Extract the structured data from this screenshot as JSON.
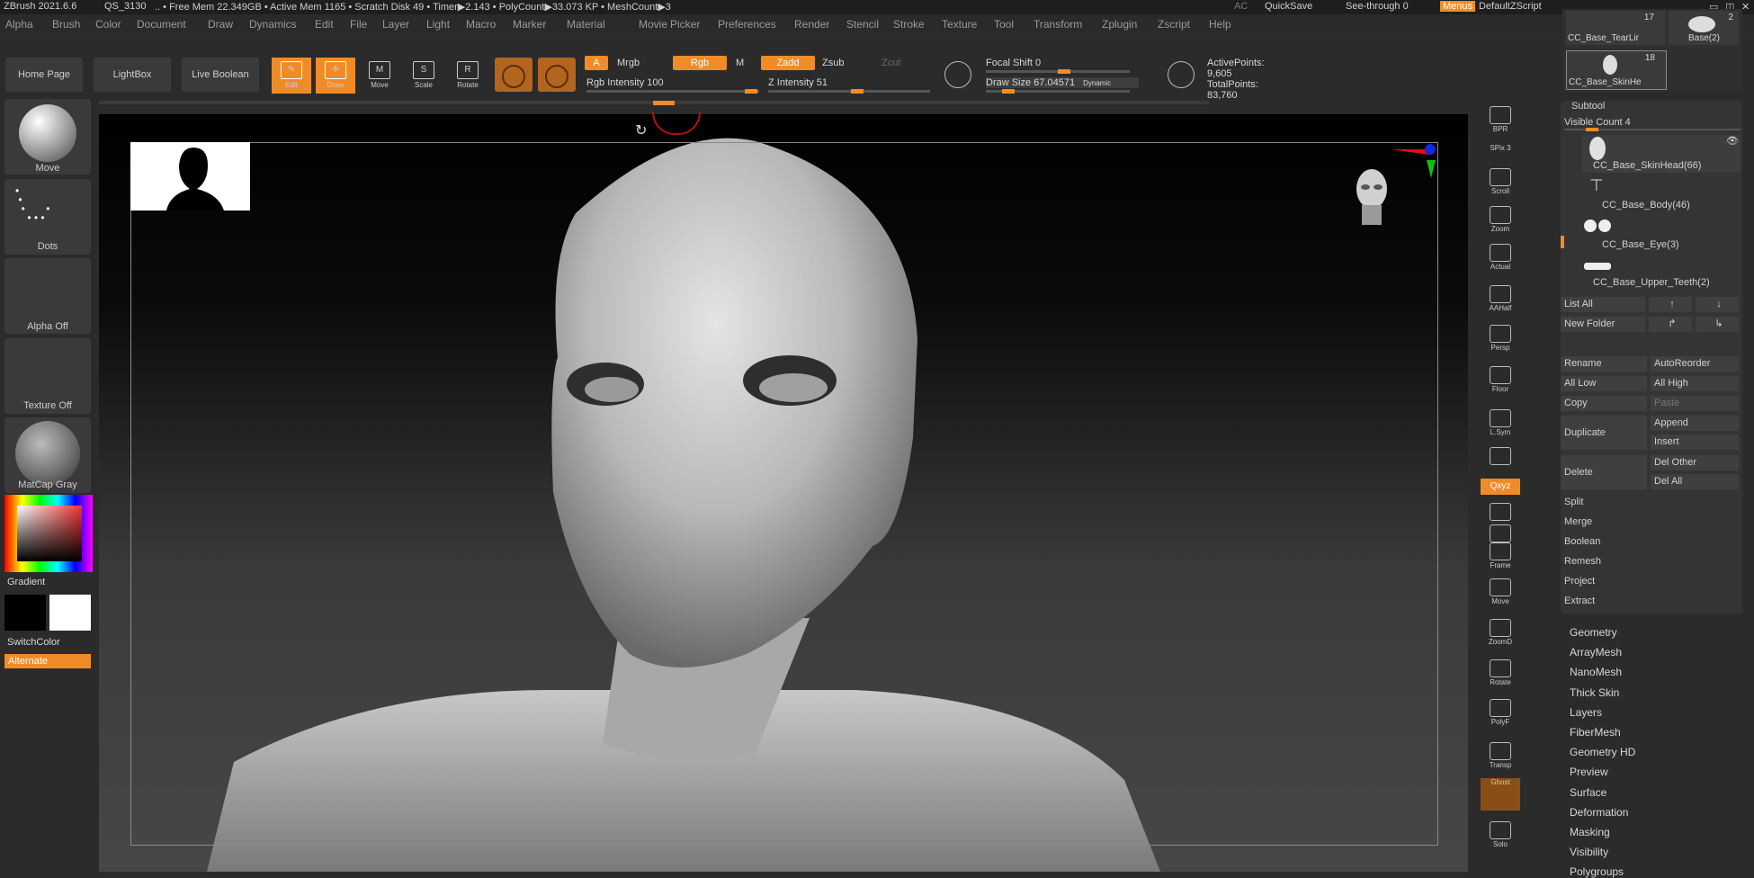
{
  "titlebar": {
    "app": "ZBrush 2021.6.6",
    "qs": "QS_3130",
    "stats": ".. • Free Mem 22.349GB • Active Mem 1165 • Scratch Disk 49 • Timer▶2.143 • PolyCount▶33.073 KP • MeshCount▶3",
    "ac": "AC",
    "quicksave": "QuickSave",
    "seethrough": "See-through  0",
    "menus": "Menus",
    "script": "DefaultZScript"
  },
  "menubar": [
    "Alpha",
    "Brush",
    "Color",
    "Document",
    "Draw",
    "Dynamics",
    "Edit",
    "File",
    "Layer",
    "Light",
    "Macro",
    "Marker",
    "Material",
    "Movie",
    "Picker",
    "Preferences",
    "Render",
    "Stencil",
    "Stroke",
    "Texture",
    "Tool",
    "Transform",
    "Zplugin",
    "Zscript",
    "Help"
  ],
  "shelf": {
    "home": "Home Page",
    "lightbox": "LightBox",
    "liveboolean": "Live Boolean",
    "edit": "Edit",
    "draw": "Draw",
    "move": "Move",
    "scale": "Scale",
    "rotate": "Rotate",
    "a": "A",
    "mrgb": "Mrgb",
    "rgb": "Rgb",
    "m": "M",
    "zadd": "Zadd",
    "zsub": "Zsub",
    "zcut": "Zcut",
    "rgb_intensity": "Rgb Intensity 100",
    "z_intensity": "Z Intensity 51",
    "focal_shift": "Focal Shift 0",
    "draw_size": "Draw Size 67.04571",
    "dynamic": "Dynamic",
    "active_points": "ActivePoints: 9,605",
    "total_points": "TotalPoints: 83,760"
  },
  "left": {
    "move": "Move",
    "dots": "Dots",
    "alpha_off": "Alpha Off",
    "texture_off": "Texture Off",
    "matcap": "MatCap Gray",
    "gradient": "Gradient",
    "switchcolor": "SwitchColor",
    "alternate": "Alternate"
  },
  "righttools": [
    "BPR",
    "SPix 3",
    "Scroll",
    "Zoom",
    "Actual",
    "AAHalf",
    "Persp",
    "Floor",
    "L.Sym",
    "",
    "Qxyz",
    "",
    "",
    "Frame",
    "Move",
    "ZoomD",
    "Rotate",
    "PolyF",
    "Transp",
    "Ghost",
    "Solo"
  ],
  "subtool": {
    "thumb1_count": "17",
    "thumb1_label": "CC_Base_TearLir",
    "thumb2_count": "2",
    "thumb2_label": "Base(2)",
    "thumb3_count": "18",
    "thumb3_label": "CC_Base_SkinHe",
    "title": "Subtool",
    "visible_count": "Visible Count 4",
    "items": [
      "CC_Base_SkinHead(66)",
      "CC_Base_Body(46)",
      "CC_Base_Eye(3)",
      "CC_Base_Upper_Teeth(2)"
    ],
    "list_all": "List All",
    "new_folder": "New Folder",
    "rename": "Rename",
    "autoreorder": "AutoReorder",
    "all_low": "All Low",
    "all_high": "All High",
    "copy": "Copy",
    "paste": "Paste",
    "duplicate": "Duplicate",
    "append": "Append",
    "insert": "Insert",
    "delete": "Delete",
    "del_other": "Del Other",
    "del_all": "Del All",
    "split": "Split",
    "merge": "Merge",
    "boolean": "Boolean",
    "remesh": "Remesh",
    "project": "Project",
    "extract": "Extract"
  },
  "sections": [
    "Geometry",
    "ArrayMesh",
    "NanoMesh",
    "Thick Skin",
    "Layers",
    "FiberMesh",
    "Geometry HD",
    "Preview",
    "Surface",
    "Deformation",
    "Masking",
    "Visibility",
    "Polygroups"
  ],
  "colors": {
    "accent": "#f08c28"
  }
}
